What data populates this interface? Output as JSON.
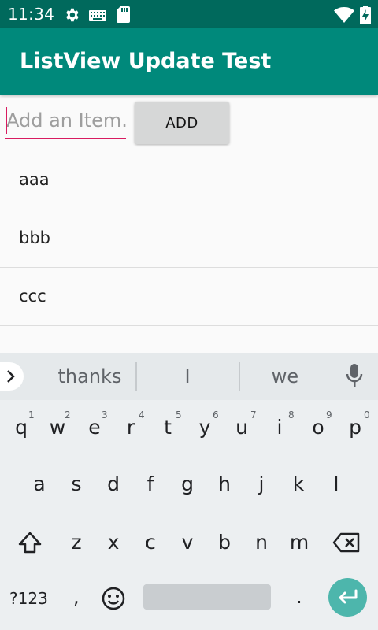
{
  "status_bar": {
    "time": "11:34",
    "icons": [
      "gear-icon",
      "keyboard-icon",
      "sd-card-icon",
      "wifi-icon",
      "battery-charging-icon"
    ]
  },
  "app_bar": {
    "title": "ListView Update Test"
  },
  "input": {
    "placeholder": "Add an Item.",
    "value": ""
  },
  "add_button": {
    "label": "ADD"
  },
  "list": {
    "items": [
      "aaa",
      "bbb",
      "ccc"
    ]
  },
  "keyboard": {
    "suggestions": [
      "thanks",
      "I",
      "we"
    ],
    "row1": [
      "q",
      "w",
      "e",
      "r",
      "t",
      "y",
      "u",
      "i",
      "o",
      "p"
    ],
    "row1_hints": [
      "1",
      "2",
      "3",
      "4",
      "5",
      "6",
      "7",
      "8",
      "9",
      "0"
    ],
    "row2": [
      "a",
      "s",
      "d",
      "f",
      "g",
      "h",
      "j",
      "k",
      "l"
    ],
    "row3": [
      "z",
      "x",
      "c",
      "v",
      "b",
      "n",
      "m"
    ],
    "symbols_label": "?123",
    "comma": ",",
    "period": "."
  },
  "colors": {
    "status_bar": "#00695c",
    "app_bar": "#00897b",
    "accent": "#d81b60",
    "enter_key": "#4db6ac"
  }
}
